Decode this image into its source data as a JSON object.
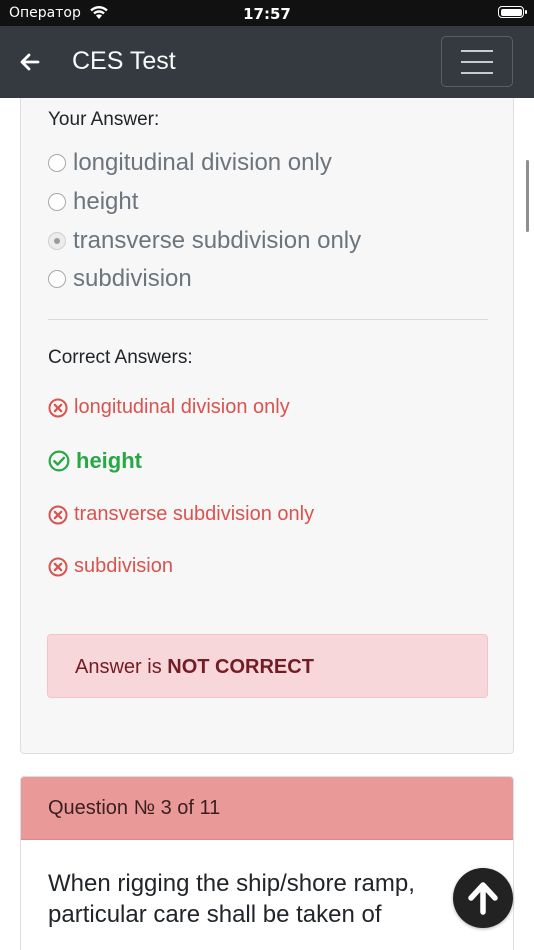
{
  "status_bar": {
    "carrier": "Оператор",
    "time": "17:57"
  },
  "navbar": {
    "title": "CES Test"
  },
  "previous_question": {
    "your_answer_label": "Your Answer:",
    "options": [
      {
        "label": "longitudinal division only",
        "selected": false
      },
      {
        "label": "height",
        "selected": false
      },
      {
        "label": "transverse subdivision only",
        "selected": true
      },
      {
        "label": "subdivision",
        "selected": false
      }
    ],
    "correct_answers_label": "Correct Answers:",
    "correct_answers": [
      {
        "label": "longitudinal division only",
        "correct": false
      },
      {
        "label": "height",
        "correct": true
      },
      {
        "label": "transverse subdivision only",
        "correct": false
      },
      {
        "label": "subdivision",
        "correct": false
      }
    ],
    "result": {
      "prefix": "Answer is",
      "verdict": "NOT CORRECT"
    }
  },
  "next_question": {
    "header": "Question № 3 of 11",
    "text": "When rigging the ship/shore ramp, particular care shall be taken of"
  },
  "colors": {
    "navbar": "#343a40",
    "wrong": "#d9534f",
    "correct": "#28a745",
    "alert_bg": "#f8d7da",
    "question_header": "#ea9999"
  }
}
